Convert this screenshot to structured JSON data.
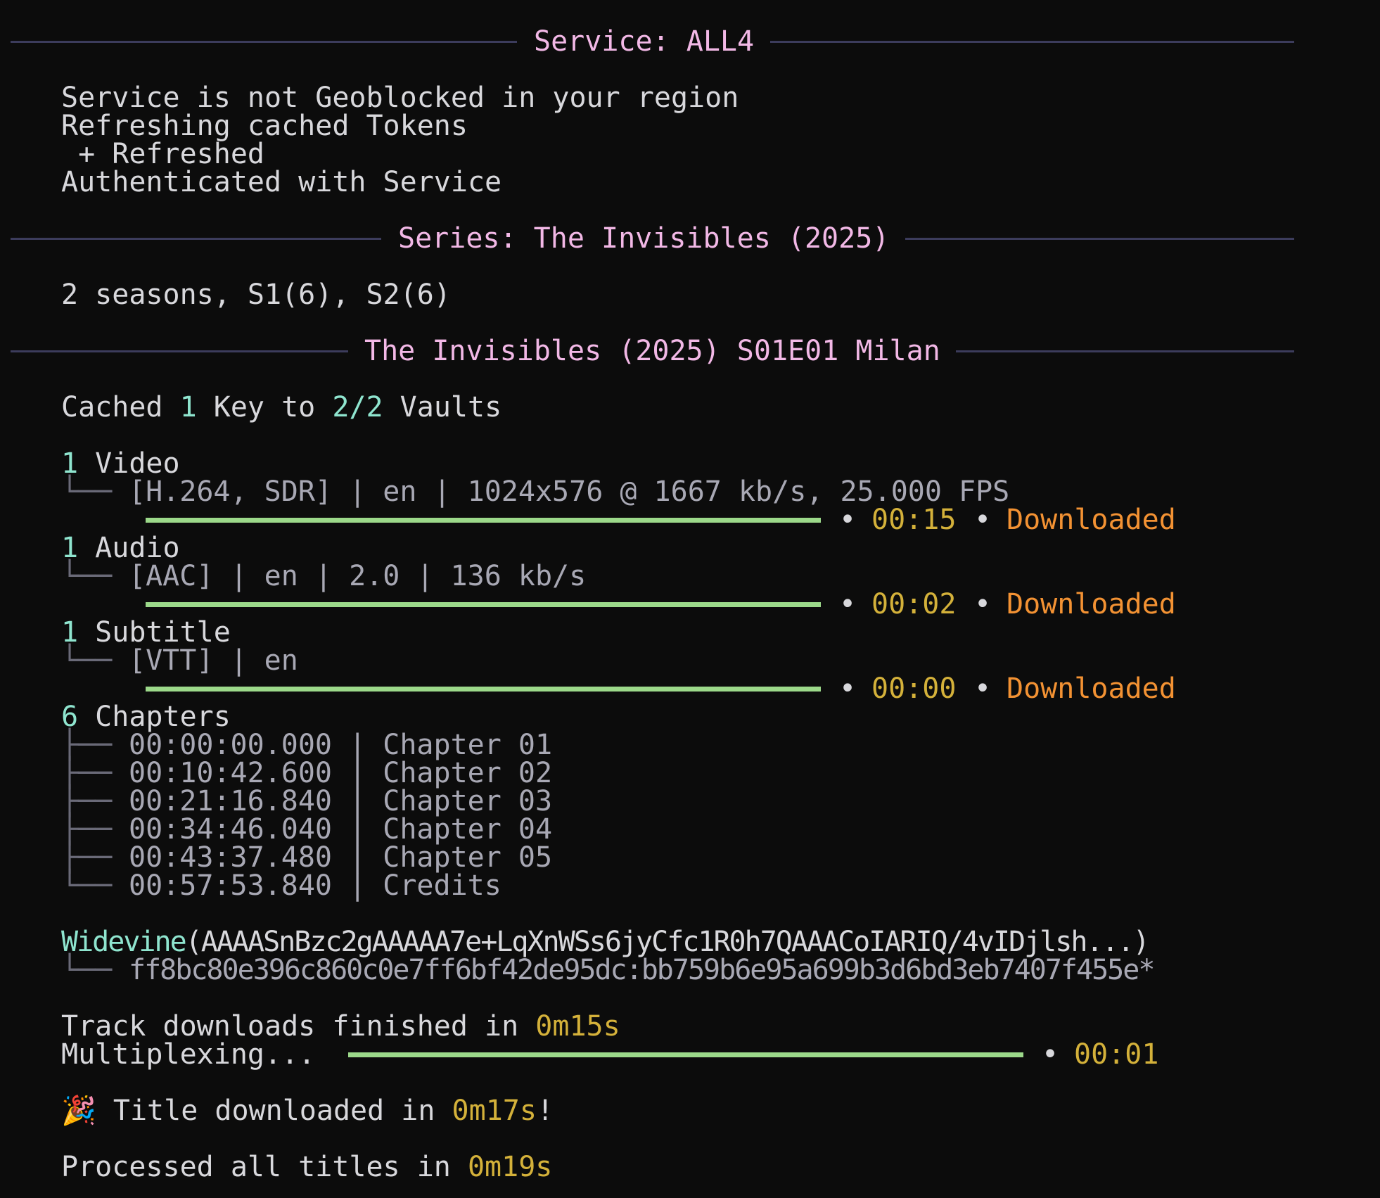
{
  "headers": {
    "service": "Service: ALL4",
    "series": "Series: The Invisibles (2025)",
    "episode": "The Invisibles (2025) S01E01 Milan"
  },
  "service_log": [
    "Service is not Geoblocked in your region",
    "Refreshing cached Tokens",
    " + Refreshed",
    "Authenticated with Service"
  ],
  "series_info": "2 seasons, S1(6), S2(6)",
  "cache": {
    "prefix": "Cached ",
    "count": "1",
    "mid": " Key to ",
    "vaults": "2/2",
    "suffix": " Vaults"
  },
  "tracks": [
    {
      "count": "1",
      "label": " Video",
      "detail": "[H.264, SDR] | en | 1024x576 @ 1667 kb/s, 25.000 FPS",
      "time": "00:15",
      "status": "Downloaded",
      "progress": 1.0
    },
    {
      "count": "1",
      "label": " Audio",
      "detail": "[AAC] | en | 2.0 | 136 kb/s",
      "time": "00:02",
      "status": "Downloaded",
      "progress": 1.0
    },
    {
      "count": "1",
      "label": " Subtitle",
      "detail": "[VTT] | en",
      "time": "00:00",
      "status": "Downloaded",
      "progress": 1.0
    }
  ],
  "chapters": {
    "count": "6",
    "label": " Chapters",
    "items": [
      {
        "time": "00:00:00.000",
        "name": "Chapter 01"
      },
      {
        "time": "00:10:42.600",
        "name": "Chapter 02"
      },
      {
        "time": "00:21:16.840",
        "name": "Chapter 03"
      },
      {
        "time": "00:34:46.040",
        "name": "Chapter 04"
      },
      {
        "time": "00:43:37.480",
        "name": "Chapter 05"
      },
      {
        "time": "00:57:53.840",
        "name": "Credits"
      }
    ]
  },
  "drm": {
    "name": "Widevine",
    "pssh": "(AAAASnBzc2gAAAAA7e+LqXnWSs6jyCfc1R0h7QAAACoIARIQ/4vIDjlsh...)",
    "key": "ff8bc80e396c860c0e7ff6bf42de95dc:bb759b6e95a699b3d6bd3eb7407f455e*"
  },
  "finish": {
    "prefix": "Track downloads finished in ",
    "time": "0m15s"
  },
  "mux": {
    "label": "Multiplexing...",
    "time": "00:01",
    "progress": 1.0
  },
  "title_done": {
    "emoji": "🎉",
    "prefix": " Title downloaded in ",
    "time": "0m17s",
    "suffix": "!"
  },
  "all_done": {
    "prefix": "Processed all titles in ",
    "time": "0m19s"
  },
  "bullet": "•",
  "colors": {
    "header": "#f2b8e6",
    "count": "#8fe5cf",
    "time": "#d4b13a",
    "status": "#f39233",
    "bar": "#9cd98a",
    "rule": "#3c3c5c"
  }
}
